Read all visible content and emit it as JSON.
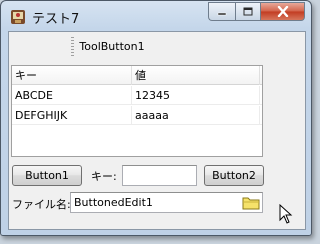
{
  "window": {
    "title": "テスト7"
  },
  "toolbar": {
    "tool_button_label": "ToolButton1"
  },
  "grid": {
    "headers": [
      "キー",
      "値"
    ],
    "rows": [
      [
        "ABCDE",
        "12345"
      ],
      [
        "DEFGHIJK",
        "aaaaa"
      ]
    ]
  },
  "controls": {
    "button1_label": "Button1",
    "key_label": "キー:",
    "key_value": "",
    "button2_label": "Button2",
    "filename_label": "ファイル名:",
    "filename_value": "ButtonedEdit1"
  },
  "icons": {
    "app": "app-icon",
    "minimize": "minimize-icon",
    "maximize": "maximize-icon",
    "close": "close-icon",
    "folder": "folder-icon",
    "cursor": "mouse-cursor-icon"
  },
  "colors": {
    "close_button": "#c83c22",
    "window_frame": "#c4d6ea",
    "folder": "#f5e26a"
  }
}
